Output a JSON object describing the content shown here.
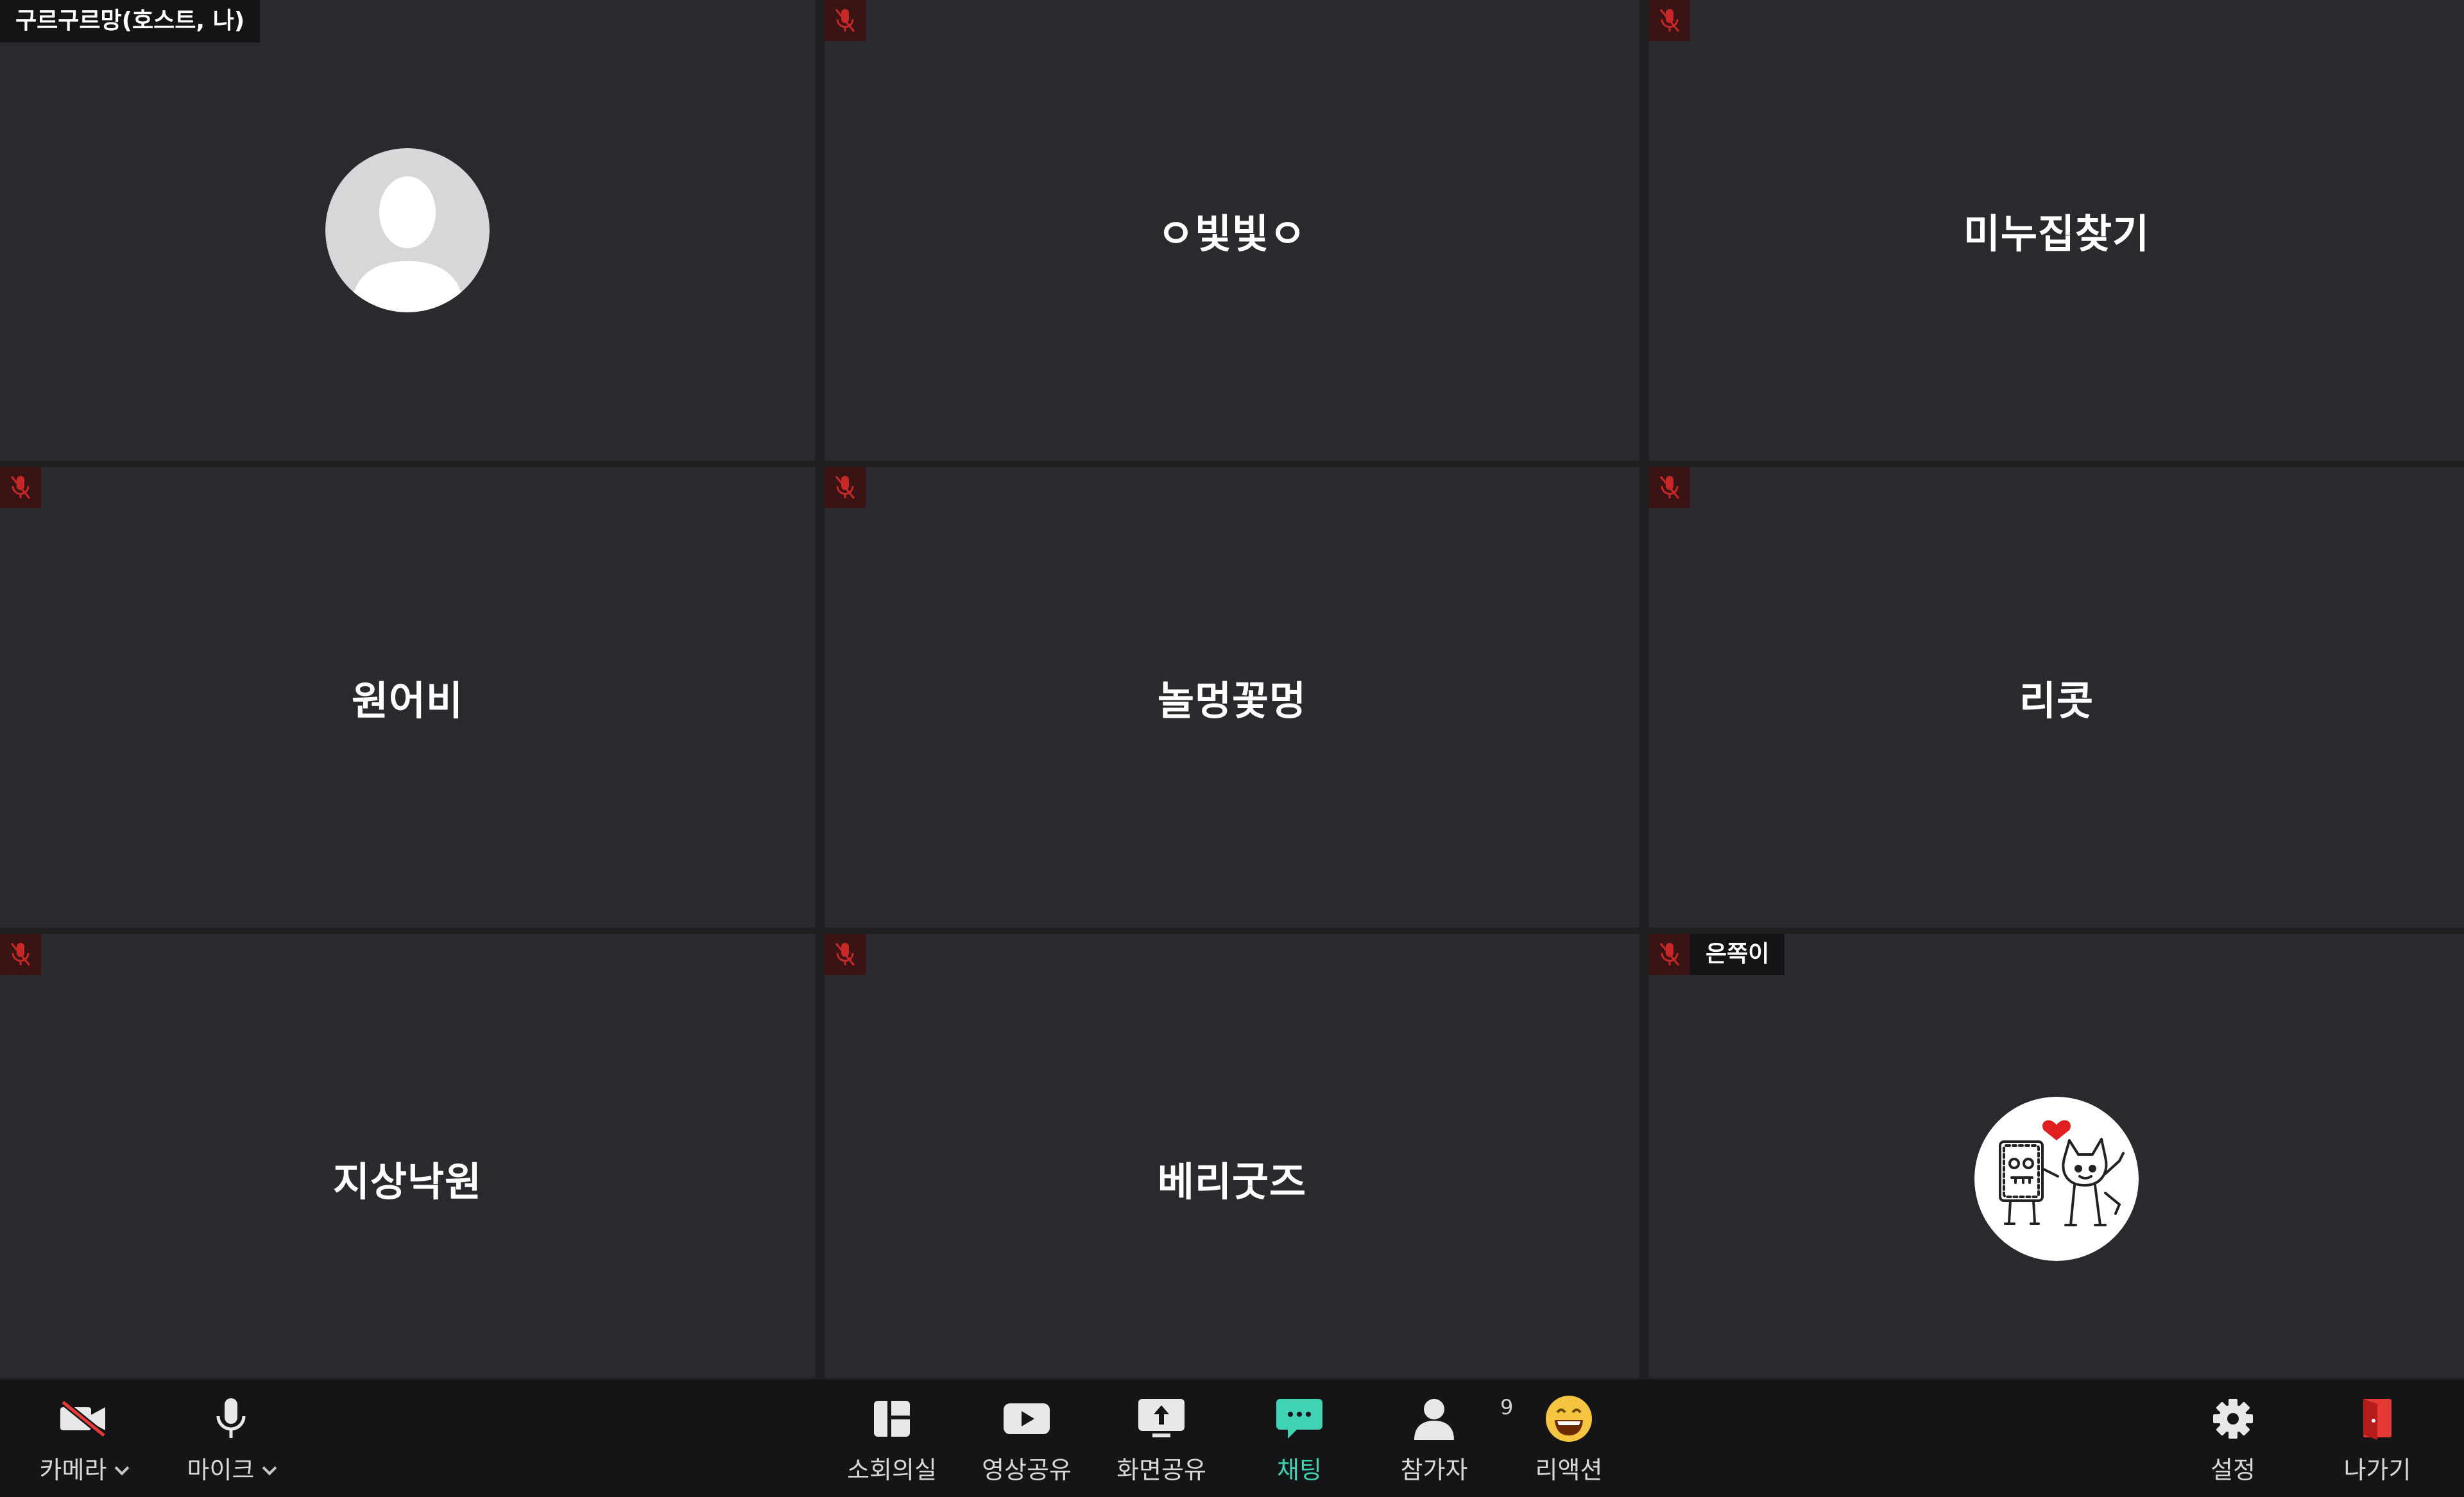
{
  "host": {
    "label": "구르구르망(호스트, 나)"
  },
  "participants": [
    {
      "name": "ㅇ빛빛ㅇ"
    },
    {
      "name": "미누집찾기"
    },
    {
      "name": "원어비"
    },
    {
      "name": "놀멍꽃멍"
    },
    {
      "name": "리콧"
    },
    {
      "name": "지상낙원"
    },
    {
      "name": "베리굿즈"
    }
  ],
  "last_tile": {
    "badge": "은쪽이"
  },
  "toolbar": {
    "camera": "카메라",
    "mic": "마이크",
    "breakout": "소회의실",
    "video_share": "영상공유",
    "screen_share": "화면공유",
    "chat": "채팅",
    "participants": "참가자",
    "participant_count": "9",
    "reaction": "리액션",
    "settings": "설정",
    "leave": "나가기"
  },
  "colors": {
    "accent": "#3fd3b4",
    "muted_red": "#c62828",
    "leave_red": "#e53935"
  },
  "icons": [
    "camera-off-icon",
    "microphone-icon",
    "breakout-room-icon",
    "video-share-icon",
    "screen-share-icon",
    "chat-icon",
    "participants-icon",
    "reaction-icon",
    "settings-icon",
    "leave-icon",
    "mic-muted-icon"
  ]
}
